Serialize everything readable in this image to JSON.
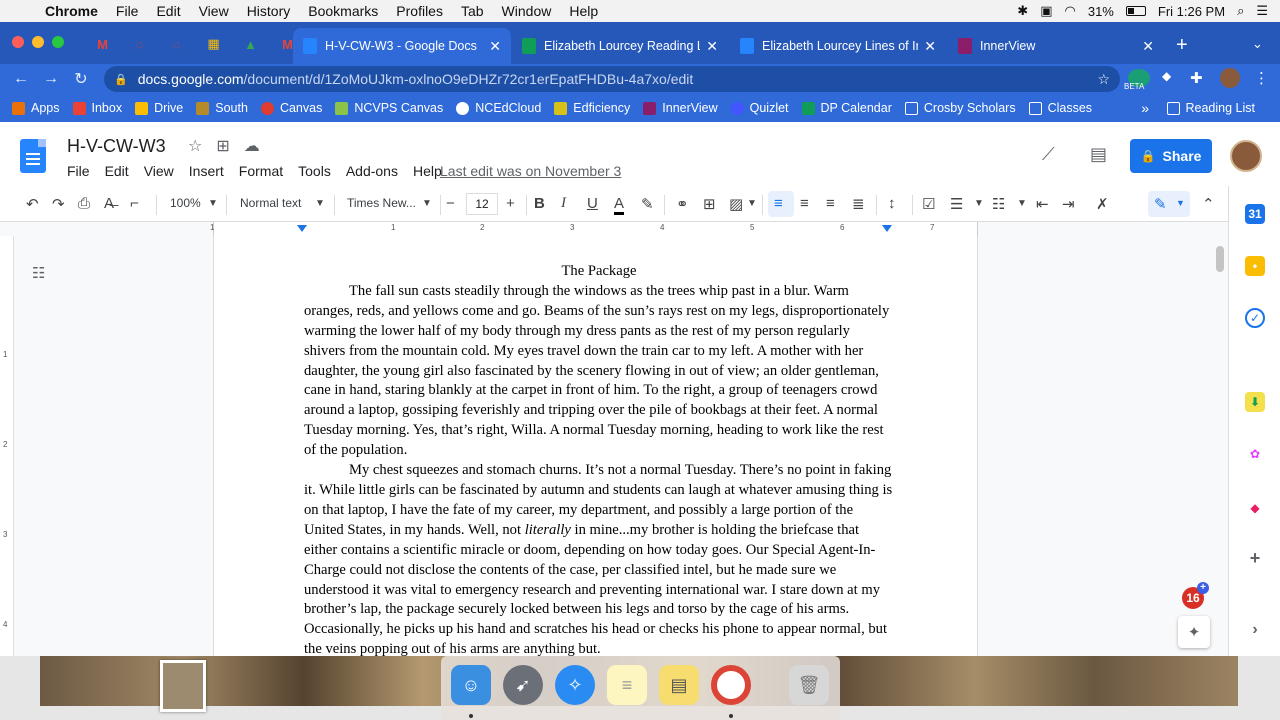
{
  "menubar": {
    "app": "Chrome",
    "items": [
      "File",
      "Edit",
      "View",
      "History",
      "Bookmarks",
      "Profiles",
      "Tab",
      "Window",
      "Help"
    ],
    "battery": "31%",
    "clock": "Fri 1:26 PM"
  },
  "tabs": [
    {
      "title": "H-V-CW-W3 - Google Docs",
      "active": true
    },
    {
      "title": "Elizabeth Lourcey Reading Lo",
      "active": false
    },
    {
      "title": "Elizabeth Lourcey Lines of Inq",
      "active": false
    },
    {
      "title": "InnerView",
      "active": false
    }
  ],
  "addressbar": {
    "host": "docs.google.com",
    "path": "/document/d/1ZoMoUJkm-oxlnoO9eDHZr72cr1erEpatFHDBu-4a7xo/edit",
    "beta_label": "BETA"
  },
  "bookmarks": [
    "Apps",
    "Inbox",
    "Drive",
    "South",
    "Canvas",
    "NCVPS Canvas",
    "NCEdCloud",
    "Edficiency",
    "InnerView",
    "Quizlet",
    "DP Calendar",
    "Crosby Scholars",
    "Classes"
  ],
  "bookmarks_more": "»",
  "reading_list": "Reading List",
  "docs": {
    "title": "H-V-CW-W3",
    "menu": [
      "File",
      "Edit",
      "View",
      "Insert",
      "Format",
      "Tools",
      "Add-ons",
      "Help"
    ],
    "last_edit": "Last edit was on November 3",
    "share_label": "Share"
  },
  "toolbar": {
    "zoom": "100%",
    "style": "Normal text",
    "font": "Times New...",
    "size": "12"
  },
  "ruler_numbers": [
    "1",
    "1",
    "2",
    "3",
    "4",
    "5",
    "6",
    "7"
  ],
  "vruler_numbers": [
    "1",
    "2",
    "3",
    "4"
  ],
  "document": {
    "heading": "The Package",
    "p1": "The fall sun casts steadily through the windows as the trees whip past in a blur. Warm oranges, reds, and yellows come and go. Beams of the sun’s rays rest on my legs, disproportionately warming the lower half of my body through my dress pants as the rest of my person regularly shivers from the mountain cold. My eyes travel down the train car to my left. A mother with her daughter, the young girl also fascinated by the scenery flowing in out of view; an older gentleman, cane in hand, staring blankly at the carpet in front of him. To the right, a group of teenagers crowd around a laptop, gossiping feverishly and tripping over the pile of bookbags at their feet. A normal Tuesday morning. Yes, that’s right, Willa. A normal Tuesday morning, heading to work like the rest of the population.",
    "p2_a": "My chest squeezes and stomach churns. It’s not a normal Tuesday. There’s no point in faking it. While little girls can be fascinated by autumn and students can laugh at whatever amusing thing is on that laptop, I have the fate of my career, my department, and possibly a large portion of the United States, in my hands. Well, not ",
    "p2_em": "literally",
    "p2_b": " in mine...my brother is holding the briefcase that either contains a scientific miracle or doom, depending on how today goes. Our Special Agent-In-Charge could not disclose the contents of the case, per classified intel, but he made sure we understood it was vital to emergency research and preventing international war.  I stare down at my brother’s lap, the package securely locked between his legs and torso by the cage of his arms. Occasionally, he picks up his hand and scratches his head or checks his phone to appear normal, but the veins popping out of his arms are anything but."
  },
  "notifications_badge": "16",
  "colors": {
    "tabstrip": "#2558b9",
    "toolbar_blue": "#2f6ad8",
    "share_button": "#1a73e8",
    "docs_icon": "#2684fc"
  }
}
